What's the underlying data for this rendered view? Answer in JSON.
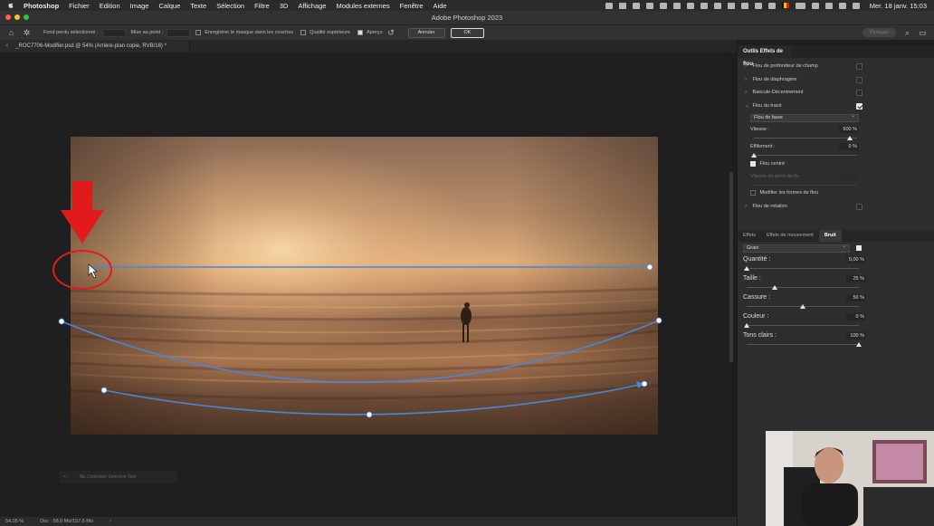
{
  "menubar": {
    "app": "Photoshop",
    "items": [
      "Fichier",
      "Edition",
      "Image",
      "Calque",
      "Texte",
      "Sélection",
      "Filtre",
      "3D",
      "Affichage",
      "Modules externes",
      "Fenêtre",
      "Aide"
    ],
    "clock": "Mer. 18 janv.  15:03"
  },
  "window": {
    "title": "Adobe Photoshop 2023"
  },
  "options": {
    "fond_label": "Fond perdu sélectionné :",
    "mise_label": "Mise au point :",
    "masque_label": "Enregistrer le masque dans les couches",
    "qualite_label": "Qualité supérieure",
    "apercu_label": "Aperçu",
    "annuler": "Annuler",
    "ok": "OK",
    "share": "Partager"
  },
  "document": {
    "tab_title": "_ROC7706-Modifier.psd @ 54% (Arrière-plan copie, RVB/16) *",
    "zoom": "54,05 %",
    "doc_info": "Doc : 58,0 Mo/157,6 Mo"
  },
  "hud": {
    "text": "Nik Collection Selective Tool"
  },
  "panel": {
    "title": "Outils Effets de flou",
    "blurs": [
      {
        "label": "Flou de profondeur de champ",
        "checked": false,
        "expanded": false
      },
      {
        "label": "Flou de diaphragme",
        "checked": false,
        "expanded": false
      },
      {
        "label": "Bascule-Décentrement",
        "checked": false,
        "expanded": false
      },
      {
        "label": "Flou du tracé",
        "checked": true,
        "expanded": true
      }
    ],
    "path_blur": {
      "type": "Flou de base",
      "vitesse_label": "Vitesse :",
      "vitesse_value": "500 %",
      "vitesse_level": 0.93,
      "effilement_label": "Effilement :",
      "effilement_value": "0 %",
      "effilement_level": 0.0,
      "flou_centre_label": "Flou centré",
      "vitesse_fin_label": "Vitesse du point de fin",
      "modifier_label": "Modifier les formes de flou"
    },
    "rotation": {
      "label": "Flou de rotation",
      "checked": false
    },
    "tabs": [
      "Effets",
      "Effets de mouvement",
      "Bruit"
    ],
    "noise": {
      "type": "Grain",
      "sliders": [
        {
          "label": "Quantité :",
          "value": "0,00 %",
          "level": 0.0
        },
        {
          "label": "Taille :",
          "value": "25 %",
          "level": 0.25
        },
        {
          "label": "Cassure :",
          "value": "50 %",
          "level": 0.5
        },
        {
          "label": "Couleur :",
          "value": "0 %",
          "level": 0.0
        },
        {
          "label": "Tons clairs :",
          "value": "100 %",
          "level": 1.0
        }
      ]
    }
  },
  "colors": {
    "path_blue": "#4a86d8",
    "annotation_red": "#e11b1b"
  }
}
